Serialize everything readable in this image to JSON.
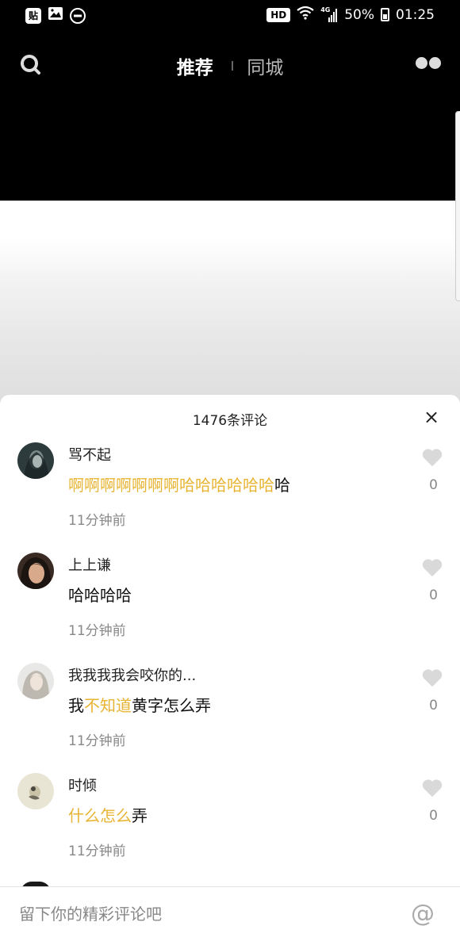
{
  "status_bar": {
    "left_icons": [
      "tieba-icon",
      "image-icon",
      "dnd-icon"
    ],
    "tieba_glyph": "贴",
    "hd_label": "HD",
    "network_label": "4G",
    "battery_percent": "50%",
    "time": "01:25"
  },
  "top_nav": {
    "tabs": [
      {
        "label": "推荐",
        "active": true
      },
      {
        "label": "同城",
        "active": false
      }
    ]
  },
  "comments_panel": {
    "count_label": "1476条评论",
    "close_glyph": "×",
    "comments": [
      {
        "user": "骂不起",
        "text_highlight": "啊啊啊啊啊啊啊哈哈哈哈哈哈",
        "text_plain": "哈",
        "time": "11分钟前",
        "likes": "0"
      },
      {
        "user": "上上谦",
        "text_plain": "哈哈哈哈",
        "time": "11分钟前",
        "likes": "0"
      },
      {
        "user": "我我我我会咬你的...",
        "text_before": "我",
        "text_highlight": "不知道",
        "text_after": "黄字怎么弄",
        "time": "11分钟前",
        "likes": "0"
      },
      {
        "user": "时倾",
        "text_highlight": "什么怎么",
        "text_after": "弄",
        "time": "11分钟前",
        "likes": "0"
      }
    ]
  },
  "input_bar": {
    "placeholder": "留下你的精彩评论吧",
    "at_glyph": "@"
  },
  "colors": {
    "highlight": "#e8b433",
    "background_top": "#000000",
    "sheet": "#ffffff",
    "secondary_text": "#888888"
  }
}
